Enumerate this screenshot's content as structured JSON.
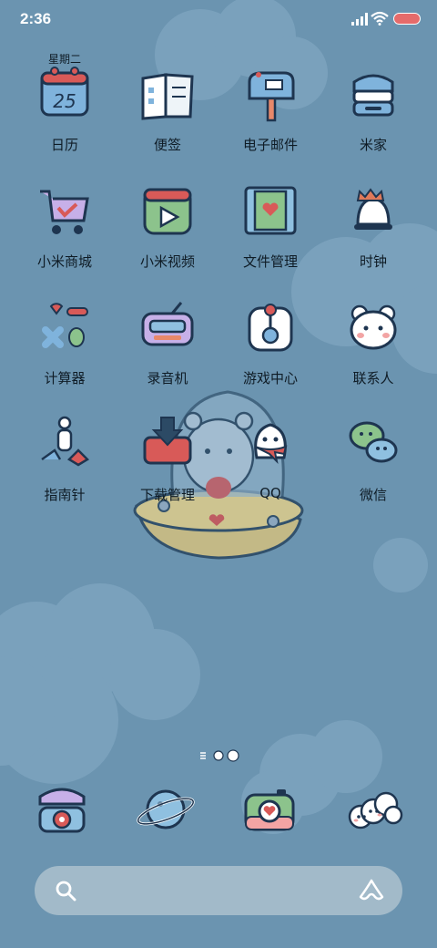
{
  "status_bar": {
    "time": "2:36",
    "icons": [
      "signal-icon",
      "wifi-icon",
      "battery-icon"
    ],
    "battery_color": "#e56b6b"
  },
  "wallpaper": {
    "background_color": "#6b94b0",
    "cloud_color": "#7aa1bc",
    "theme": "cute bear in flying saucer"
  },
  "calendar_weekday": "星期二",
  "calendar_date": "25",
  "apps": [
    {
      "label": "日历",
      "icon": "calendar-icon"
    },
    {
      "label": "便签",
      "icon": "notes-icon"
    },
    {
      "label": "电子邮件",
      "icon": "mailbox-icon"
    },
    {
      "label": "米家",
      "icon": "mijia-icon"
    },
    {
      "label": "小米商城",
      "icon": "shopping-cart-icon"
    },
    {
      "label": "小米视频",
      "icon": "video-play-icon"
    },
    {
      "label": "文件管理",
      "icon": "film-heart-icon"
    },
    {
      "label": "时钟",
      "icon": "alarm-bell-icon"
    },
    {
      "label": "计算器",
      "icon": "calculator-icon"
    },
    {
      "label": "录音机",
      "icon": "radio-recorder-icon"
    },
    {
      "label": "游戏中心",
      "icon": "joystick-icon"
    },
    {
      "label": "联系人",
      "icon": "bear-face-icon"
    },
    {
      "label": "指南针",
      "icon": "compass-figure-icon"
    },
    {
      "label": "下载管理",
      "icon": "download-tray-icon"
    },
    {
      "label": "QQ",
      "icon": "qq-penguin-icon"
    },
    {
      "label": "微信",
      "icon": "wechat-bubbles-icon"
    }
  ],
  "dock": [
    {
      "icon": "phone-icon"
    },
    {
      "icon": "planet-browser-icon"
    },
    {
      "icon": "camera-icon"
    },
    {
      "icon": "cloud-messages-icon"
    }
  ],
  "search_bar": {
    "left_icon": "search-icon",
    "right_icon": "assistant-icon"
  }
}
